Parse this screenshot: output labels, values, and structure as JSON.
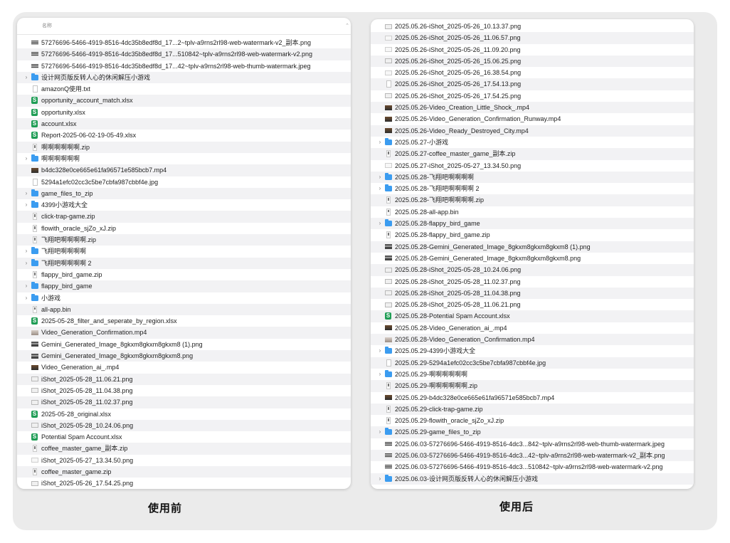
{
  "before": {
    "header_label": "名称",
    "sort_glyph": "⌃",
    "caption": "使用前",
    "rows": [
      {
        "name": "57276696-5466-4919-8516-4dc35b8edf8d_17...2~tplv-a9rns2rl98-web-watermark-v2_副本.png",
        "icon": "img-striped",
        "folder": false
      },
      {
        "name": "57276696-5466-4919-8516-4dc35b8edf8d_17...510842~tplv-a9rns2rl98-web-watermark-v2.png",
        "icon": "img-striped",
        "folder": false
      },
      {
        "name": "57276696-5466-4919-8516-4dc35b8edf8d_17...42~tplv-a9rns2rl98-web-thumb-watermark.jpeg",
        "icon": "img-striped",
        "folder": false
      },
      {
        "name": "设计网页版反转人心的休闲解压小游戏",
        "icon": "folder",
        "folder": true
      },
      {
        "name": "amazonQ使用.txt",
        "icon": "doc",
        "folder": false
      },
      {
        "name": "opportunity_account_match.xlsx",
        "icon": "xlsx",
        "folder": false
      },
      {
        "name": "opportunity.xlsx",
        "icon": "xlsx",
        "folder": false
      },
      {
        "name": "account.xlsx",
        "icon": "xlsx",
        "folder": false
      },
      {
        "name": "Report-2025-06-02-19-05-49.xlsx",
        "icon": "xlsx",
        "folder": false
      },
      {
        "name": "啊啊啊啊啊啊.zip",
        "icon": "zip",
        "folder": false
      },
      {
        "name": "啊啊啊啊啊啊",
        "icon": "folder",
        "folder": true
      },
      {
        "name": "b4dc328e0ce665e61fa96571e585bcb7.mp4",
        "icon": "video",
        "folder": false
      },
      {
        "name": "5294a1efc02cc3c5be7cbfa987cbbf4e.jpg",
        "icon": "doc",
        "folder": false
      },
      {
        "name": "game_files_to_zip",
        "icon": "folder",
        "folder": true
      },
      {
        "name": "4399小游戏大全",
        "icon": "folder",
        "folder": true
      },
      {
        "name": "click-trap-game.zip",
        "icon": "zip",
        "folder": false
      },
      {
        "name": "flowith_oracle_sjZo_xJ.zip",
        "icon": "zip",
        "folder": false
      },
      {
        "name": "飞翔吧啊啊啊啊.zip",
        "icon": "zip",
        "folder": false
      },
      {
        "name": "飞翔吧啊啊啊啊",
        "icon": "folder",
        "folder": true
      },
      {
        "name": "飞翔吧啊啊啊啊 2",
        "icon": "folder",
        "folder": true
      },
      {
        "name": "flappy_bird_game.zip",
        "icon": "zip",
        "folder": false
      },
      {
        "name": "flappy_bird_game",
        "icon": "folder",
        "folder": true
      },
      {
        "name": "小游戏",
        "icon": "folder",
        "folder": true
      },
      {
        "name": "all-app.bin",
        "icon": "bin",
        "folder": false
      },
      {
        "name": "2025-05-28_filter_and_seperate_by_region.xlsx",
        "icon": "xlsx",
        "folder": false
      },
      {
        "name": "Video_Generation_Confirmation.mp4",
        "icon": "videolight",
        "folder": false
      },
      {
        "name": "Gemini_Generated_Image_8gkxm8gkxm8gkxm8 (1).png",
        "icon": "imgdark",
        "folder": false
      },
      {
        "name": "Gemini_Generated_Image_8gkxm8gkxm8gkxm8.png",
        "icon": "imgdark",
        "folder": false
      },
      {
        "name": "Video_Generation_ai_.mp4",
        "icon": "video",
        "folder": false
      },
      {
        "name": "iShot_2025-05-28_11.06.21.png",
        "icon": "img",
        "folder": false
      },
      {
        "name": "iShot_2025-05-28_11.04.38.png",
        "icon": "img",
        "folder": false
      },
      {
        "name": "iShot_2025-05-28_11.02.37.png",
        "icon": "img",
        "folder": false
      },
      {
        "name": "2025-05-28_original.xlsx",
        "icon": "xlsx",
        "folder": false
      },
      {
        "name": "iShot_2025-05-28_10.24.06.png",
        "icon": "img",
        "folder": false
      },
      {
        "name": "Potential Spam Account.xlsx",
        "icon": "xlsx",
        "folder": false
      },
      {
        "name": "coffee_master_game_副本.zip",
        "icon": "zip",
        "folder": false
      },
      {
        "name": "iShot_2025-05-27_13.34.50.png",
        "icon": "blank",
        "folder": false
      },
      {
        "name": "coffee_master_game.zip",
        "icon": "zip",
        "folder": false
      },
      {
        "name": "iShot_2025-05-26_17.54.25.png",
        "icon": "img",
        "folder": false
      }
    ]
  },
  "after": {
    "caption": "使用后",
    "rows": [
      {
        "name": "2025.05.26-iShot_2025-05-26_10.13.37.png",
        "icon": "img",
        "folder": false
      },
      {
        "name": "2025.05.26-iShot_2025-05-26_11.06.57.png",
        "icon": "blank",
        "folder": false
      },
      {
        "name": "2025.05.26-iShot_2025-05-26_11.09.20.png",
        "icon": "blank",
        "folder": false
      },
      {
        "name": "2025.05.26-iShot_2025-05-26_15.06.25.png",
        "icon": "img",
        "folder": false
      },
      {
        "name": "2025.05.26-iShot_2025-05-26_16.38.54.png",
        "icon": "blank",
        "folder": false
      },
      {
        "name": "2025.05.26-iShot_2025-05-26_17.54.13.png",
        "icon": "doc",
        "folder": false
      },
      {
        "name": "2025.05.26-iShot_2025-05-26_17.54.25.png",
        "icon": "img",
        "folder": false
      },
      {
        "name": "2025.05.26-Video_Creation_Little_Shock_.mp4",
        "icon": "video",
        "folder": false
      },
      {
        "name": "2025.05.26-Video_Generation_Confirmation_Runway.mp4",
        "icon": "video",
        "folder": false
      },
      {
        "name": "2025.05.26-Video_Ready_Destroyed_City.mp4",
        "icon": "video",
        "folder": false
      },
      {
        "name": "2025.05.27-小游戏",
        "icon": "folder",
        "folder": true
      },
      {
        "name": "2025.05.27-coffee_master_game_副本.zip",
        "icon": "zip",
        "folder": false
      },
      {
        "name": "2025.05.27-iShot_2025-05-27_13.34.50.png",
        "icon": "blank",
        "folder": false
      },
      {
        "name": "2025.05.28-飞翔吧啊啊啊啊",
        "icon": "folder",
        "folder": true
      },
      {
        "name": "2025.05.28-飞翔吧啊啊啊啊 2",
        "icon": "folder",
        "folder": true
      },
      {
        "name": "2025.05.28-飞翔吧啊啊啊啊.zip",
        "icon": "zip",
        "folder": false
      },
      {
        "name": "2025.05.28-all-app.bin",
        "icon": "bin",
        "folder": false
      },
      {
        "name": "2025.05.28-flappy_bird_game",
        "icon": "folder",
        "folder": true
      },
      {
        "name": "2025.05.28-flappy_bird_game.zip",
        "icon": "zip",
        "folder": false
      },
      {
        "name": "2025.05.28-Gemini_Generated_Image_8gkxm8gkxm8gkxm8 (1).png",
        "icon": "imgdark",
        "folder": false
      },
      {
        "name": "2025.05.28-Gemini_Generated_Image_8gkxm8gkxm8gkxm8.png",
        "icon": "imgdark",
        "folder": false
      },
      {
        "name": "2025.05.28-iShot_2025-05-28_10.24.06.png",
        "icon": "img",
        "folder": false
      },
      {
        "name": "2025.05.28-iShot_2025-05-28_11.02.37.png",
        "icon": "img",
        "folder": false
      },
      {
        "name": "2025.05.28-iShot_2025-05-28_11.04.38.png",
        "icon": "img",
        "folder": false
      },
      {
        "name": "2025.05.28-iShot_2025-05-28_11.06.21.png",
        "icon": "img",
        "folder": false
      },
      {
        "name": "2025.05.28-Potential Spam Account.xlsx",
        "icon": "xlsx",
        "folder": false
      },
      {
        "name": "2025.05.28-Video_Generation_ai_.mp4",
        "icon": "video",
        "folder": false
      },
      {
        "name": "2025.05.28-Video_Generation_Confirmation.mp4",
        "icon": "videolight",
        "folder": false
      },
      {
        "name": "2025.05.29-4399小游戏大全",
        "icon": "folder",
        "folder": true
      },
      {
        "name": "2025.05.29-5294a1efc02cc3c5be7cbfa987cbbf4e.jpg",
        "icon": "doc",
        "folder": false
      },
      {
        "name": "2025.05.29-啊啊啊啊啊啊",
        "icon": "folder",
        "folder": true
      },
      {
        "name": "2025.05.29-啊啊啊啊啊啊.zip",
        "icon": "zip",
        "folder": false
      },
      {
        "name": "2025.05.29-b4dc328e0ce665e61fa96571e585bcb7.mp4",
        "icon": "video",
        "folder": false
      },
      {
        "name": "2025.05.29-click-trap-game.zip",
        "icon": "zip",
        "folder": false
      },
      {
        "name": "2025.05.29-flowith_oracle_sjZo_xJ.zip",
        "icon": "zip",
        "folder": false
      },
      {
        "name": "2025.05.29-game_files_to_zip",
        "icon": "folder",
        "folder": true
      },
      {
        "name": "2025.06.03-57276696-5466-4919-8516-4dc3...842~tplv-a9rns2rl98-web-thumb-watermark.jpeg",
        "icon": "img-striped",
        "folder": false
      },
      {
        "name": "2025.06.03-57276696-5466-4919-8516-4dc3...42~tplv-a9rns2rl98-web-watermark-v2_副本.png",
        "icon": "img-striped",
        "folder": false
      },
      {
        "name": "2025.06.03-57276696-5466-4919-8516-4dc3...510842~tplv-a9rns2rl98-web-watermark-v2.png",
        "icon": "img-striped",
        "folder": false
      },
      {
        "name": "2025.06.03-设计网页版反转人心的休闲解压小游戏",
        "icon": "folder",
        "folder": true
      }
    ]
  }
}
